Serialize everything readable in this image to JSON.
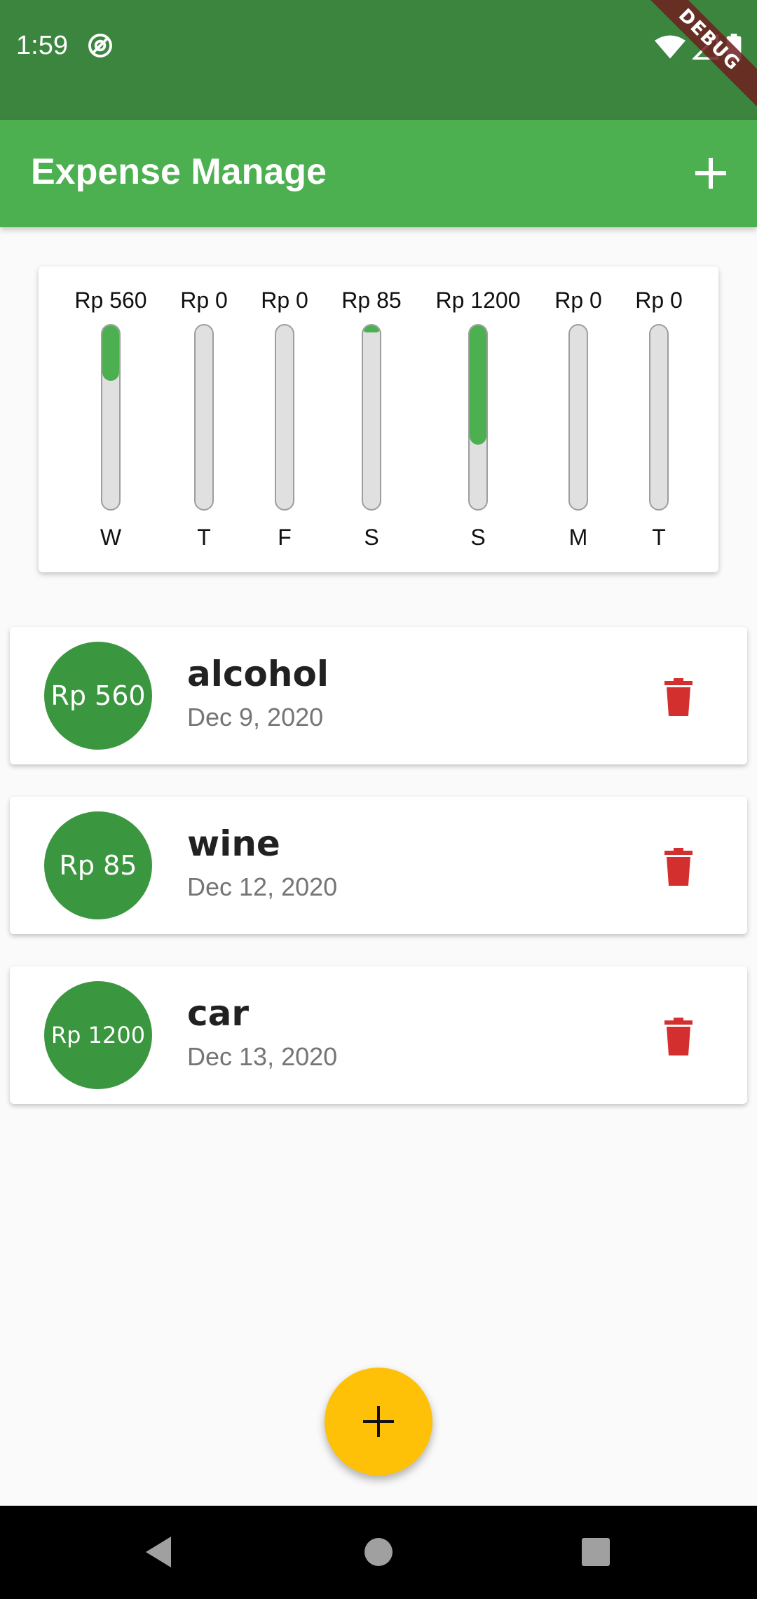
{
  "status_bar": {
    "time": "1:59",
    "debug_label": "DEBUG"
  },
  "app_bar": {
    "title": "Expense Manage"
  },
  "chart_data": {
    "type": "bar",
    "categories": [
      "W",
      "T",
      "F",
      "S",
      "S",
      "M",
      "T"
    ],
    "values": [
      560,
      0,
      0,
      85,
      1200,
      0,
      0
    ],
    "labels": [
      "Rp 560",
      "Rp 0",
      "Rp 0",
      "Rp 85",
      "Rp 1200",
      "Rp 0",
      "Rp 0"
    ],
    "fill_fraction": [
      0.3,
      0,
      0,
      0.04,
      0.65,
      0,
      0
    ],
    "bar_color": "#4caf50",
    "track_color": "#e0e0e0"
  },
  "transactions": [
    {
      "amount": "Rp 560",
      "title": "alcohol",
      "date": "Dec 9, 2020"
    },
    {
      "amount": "Rp 85",
      "title": "wine",
      "date": "Dec 12, 2020"
    },
    {
      "amount": "Rp 1200",
      "title": "car",
      "date": "Dec 13, 2020"
    }
  ],
  "colors": {
    "status_bar": "#3c853f",
    "app_bar": "#4caf50",
    "amount_circle": "#3b9640",
    "delete": "#d32f2f",
    "fab": "#ffc107"
  },
  "icons": {
    "app_add": "plus-icon",
    "delete": "trash-icon",
    "fab": "plus-icon",
    "nav_back": "triangle-back-icon",
    "nav_home": "circle-home-icon",
    "nav_recents": "square-recents-icon"
  }
}
